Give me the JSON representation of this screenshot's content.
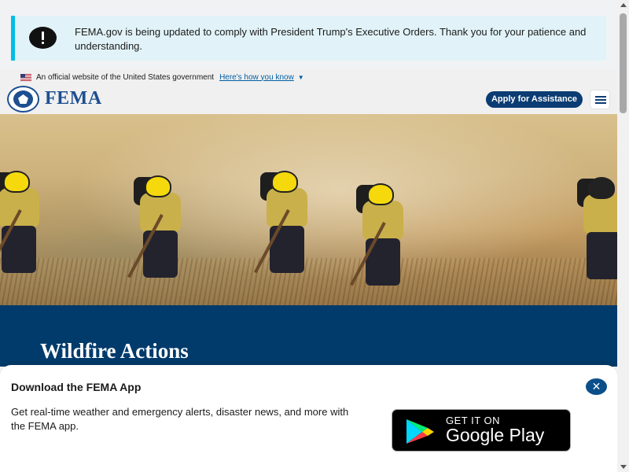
{
  "alert": {
    "icon": "alert-icon",
    "message": "FEMA.gov is being updated to comply with President Trump's Executive Orders. Thank you for your patience and understanding."
  },
  "gov_banner": {
    "flag_icon": "us-flag-icon",
    "text": "An official website of the United States government",
    "link": "Here's how you know",
    "chevron_icon": "chevron-down-icon"
  },
  "header": {
    "logo_icon": "dhs-seal-icon",
    "logo_text": "FEMA",
    "apply_button": "Apply for Assistance",
    "menu_icon": "hamburger-menu-icon"
  },
  "hero": {
    "image": "wildfire-crew-photo"
  },
  "page": {
    "title": "Wildfire Actions"
  },
  "app_sheet": {
    "title": "Download the FEMA App",
    "close_icon": "close-icon",
    "text": "Get real-time weather and emergency alerts, disaster news, and more with the FEMA app.",
    "badge_small": "GET IT ON",
    "badge_big": "Google Play"
  },
  "colors": {
    "brand_blue": "#0b3c73",
    "alert_bg": "#e1f3f8",
    "alert_border": "#00bde3",
    "section_dark": "#003b6b"
  }
}
